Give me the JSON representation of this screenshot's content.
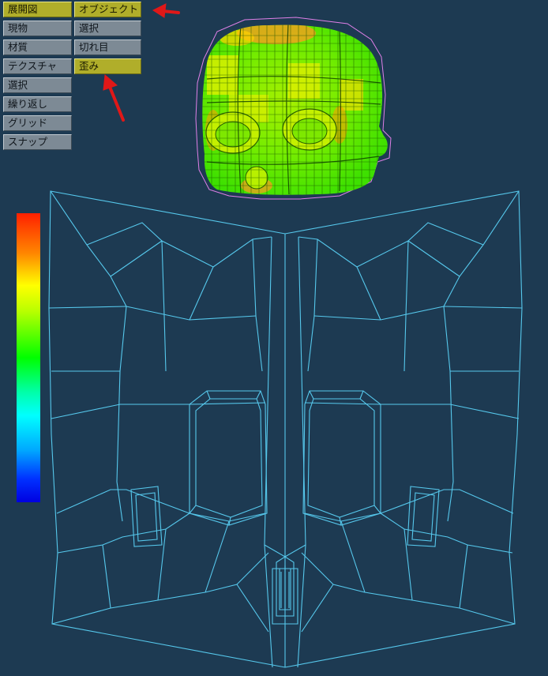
{
  "left_menu": [
    {
      "label": "展開図",
      "active": true
    },
    {
      "label": "現物",
      "active": false
    },
    {
      "label": "材質",
      "active": false
    },
    {
      "label": "テクスチャ",
      "active": false
    },
    {
      "label": "選択",
      "active": false
    },
    {
      "label": "繰り返し",
      "active": false
    },
    {
      "label": "グリッド",
      "active": false
    },
    {
      "label": "スナップ",
      "active": false
    }
  ],
  "right_menu": [
    {
      "label": "オブジェクト",
      "active": true
    },
    {
      "label": "選択",
      "active": false
    },
    {
      "label": "切れ目",
      "active": false
    },
    {
      "label": "歪み",
      "active": true
    }
  ],
  "colors": {
    "background": "#1d3a52",
    "active_button": "#b0ae2a",
    "inactive_button": "#7d8a95",
    "uv_wireframe": "#56c8ec",
    "annotation_arrow": "#e01818"
  },
  "colorbar": {
    "top_color": "#ff2000",
    "bottom_color": "#0000e0"
  },
  "icons": [
    "red-arrow-icon"
  ]
}
